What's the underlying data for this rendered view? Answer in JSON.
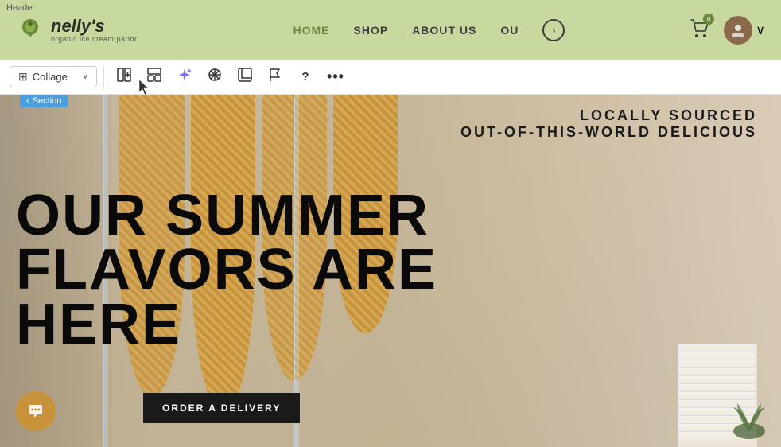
{
  "header": {
    "label": "Header",
    "logo": {
      "text": "nelly's",
      "subtext": "organic ice cream parlor"
    },
    "nav": {
      "items": [
        {
          "label": "HOME",
          "state": "active"
        },
        {
          "label": "SHOP",
          "state": "inactive"
        },
        {
          "label": "ABOUT US",
          "state": "highlight"
        },
        {
          "label": "OU",
          "state": "inactive"
        }
      ],
      "more_icon": "›"
    },
    "cart": {
      "icon": "🛒",
      "badge": "0"
    },
    "avatar_initial": "👤",
    "dropdown_icon": "∨"
  },
  "toolbar": {
    "collage_label": "Collage",
    "buttons": [
      {
        "id": "add-column",
        "icon": "⊞",
        "tooltip": "Add column"
      },
      {
        "id": "layout",
        "icon": "⊟",
        "tooltip": "Layout"
      },
      {
        "id": "ai",
        "icon": "✦",
        "tooltip": "AI tools",
        "active": true
      },
      {
        "id": "arrange",
        "icon": "⊕",
        "tooltip": "Arrange"
      },
      {
        "id": "crop",
        "icon": "⊡",
        "tooltip": "Crop"
      },
      {
        "id": "flag",
        "icon": "⚑",
        "tooltip": "Flag"
      },
      {
        "id": "help",
        "icon": "?",
        "tooltip": "Help"
      },
      {
        "id": "more",
        "icon": "•••",
        "tooltip": "More"
      }
    ]
  },
  "section_badge": {
    "arrow": "‹",
    "label": "Section"
  },
  "hero": {
    "top_right_line1": "LOCALLY SOURCED",
    "top_right_line2": "OUT-OF-THIS-WORLD DELICIOUS",
    "main_heading_line1": "OUR SUMMER",
    "main_heading_line2": "FLAVORS ARE",
    "main_heading_line3": "HERE",
    "cta_button": "ORDER A DELIVERY"
  },
  "chat": {
    "icon": "💬"
  }
}
